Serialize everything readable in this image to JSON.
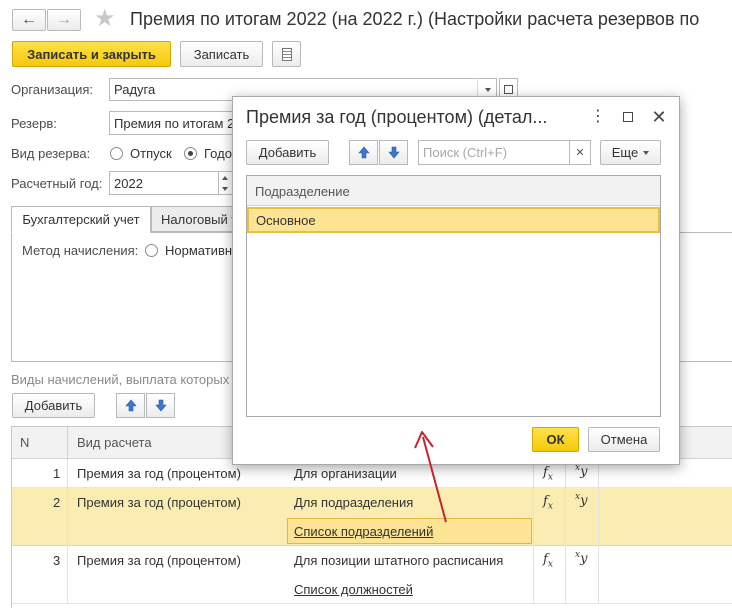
{
  "window": {
    "title": "Премия по итогам 2022 (на 2022 г.) (Настройки расчета резервов по"
  },
  "toolbar": {
    "save_close_label": "Записать и закрыть",
    "save_label": "Записать"
  },
  "form": {
    "organization_label": "Организация:",
    "organization_value": "Радуга",
    "reserve_label": "Резерв:",
    "reserve_value": "Премия по итогам 2",
    "reserve_type_label": "Вид резерва:",
    "reserve_type_opt1": "Отпуск",
    "reserve_type_opt2": "Годо",
    "year_label": "Расчетный год:",
    "year_value": "2022"
  },
  "tabs": [
    {
      "label": "Бухгалтерский учет"
    },
    {
      "label": "Налоговый у"
    }
  ],
  "accounting": {
    "method_label": "Метод начисления:",
    "method_opt1": "Нормативн"
  },
  "accruals": {
    "caption": "Виды начислений, выплата которых",
    "add_label": "Добавить",
    "headers": {
      "n": "N",
      "type": "Вид расчета"
    },
    "rows": [
      {
        "n": "1",
        "type": "Премия за год (процентом)",
        "scope": "Для организации",
        "link": ""
      },
      {
        "n": "2",
        "type": "Премия за год (процентом)",
        "scope": "Для подразделения",
        "link": "Список подразделений"
      },
      {
        "n": "3",
        "type": "Премия за год (процентом)",
        "scope": "Для позиции штатного расписания",
        "link": "Список должностей"
      }
    ],
    "fx_symbol": "fx",
    "xy_symbol": "xy"
  },
  "dialog": {
    "title": "Премия за год (процентом) (детал...",
    "add_label": "Добавить",
    "search_placeholder": "Поиск (Ctrl+F)",
    "more_label": "Еще",
    "column_header": "Подразделение",
    "rows": [
      {
        "name": "Основное"
      }
    ],
    "ok_label": "ОК",
    "cancel_label": "Отмена"
  },
  "colors": {
    "accent_yellow": "#f6c80a",
    "selected_row": "#fbedb1",
    "selected_cell": "#fde394",
    "annotation_red": "#c4242b",
    "link_blue": "#1f4f9b"
  }
}
